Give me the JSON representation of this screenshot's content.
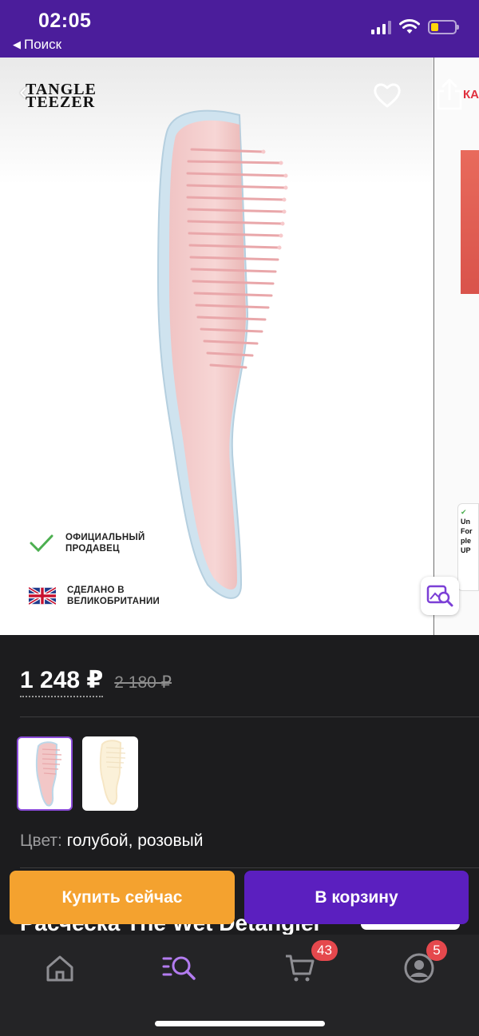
{
  "status_bar": {
    "time": "02:05",
    "back_app": "Поиск",
    "icons": [
      "cellular-signal-icon",
      "wifi-icon",
      "battery-low-icon"
    ],
    "battery_level": 0.25
  },
  "gallery": {
    "brand_line1": "TANGLE",
    "brand_line2": "TEEZER",
    "badges": [
      {
        "line1": "ОФИЦИАЛЬНЫЙ",
        "line2": "ПРОДАВЕЦ"
      },
      {
        "line1": "СДЕЛАНО В",
        "line2": "ВЕЛИКОБРИТАНИИ"
      }
    ],
    "next_slide_peek": {
      "label": "КА",
      "card_line1": "Un",
      "card_line2": "For",
      "card_line3": "ple",
      "card_line4": "UP"
    }
  },
  "price": {
    "current": "1 248 ₽",
    "old": "2 180 ₽"
  },
  "color": {
    "label": "Цвет:",
    "value": "голубой, розовый"
  },
  "product_title": "Расческа The Wet Detangler",
  "actions": {
    "buy_now": "Купить сейчас",
    "add_to_cart": "В корзину"
  },
  "tabbar": {
    "cart_count": "43",
    "profile_count": "5"
  },
  "colors": {
    "status_bar_bg": "#4b1d9b",
    "accent_purple": "#5b1fbf",
    "buy_orange": "#f4a22f",
    "badge_red": "#e5484d",
    "catalog_icon": "#b37cf0"
  }
}
